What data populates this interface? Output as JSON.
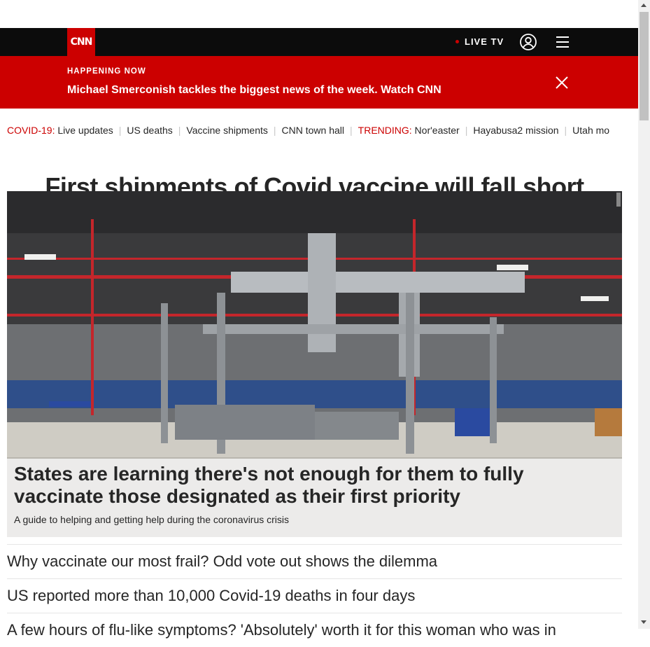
{
  "header": {
    "logo_text": "CNN",
    "live_tv_label": "LIVE TV",
    "user_icon": "user-icon",
    "menu_icon": "hamburger-menu-icon"
  },
  "banner": {
    "label": "HAPPENING NOW",
    "text": "Michael Smerconish tackles the biggest news of the week. Watch CNN",
    "close_icon": "close-icon"
  },
  "trending_bar": {
    "covid_label": "COVID-19:",
    "covid_items": [
      "Live updates",
      "US deaths",
      "Vaccine shipments",
      "CNN town hall"
    ],
    "trending_label": "TRENDING:",
    "trending_items": [
      "Nor'easter",
      "Hayabusa2 mission",
      "Utah mo"
    ]
  },
  "main": {
    "headline": "First shipments of Covid vaccine will fall short",
    "hero": {
      "title": "States are learning there's not enough for them to fully vaccinate those designated as their first priority",
      "subtitle": "A guide to helping and getting help during the coronavirus crisis"
    },
    "stories": [
      "Why vaccinate our most frail? Odd vote out shows the dilemma",
      "US reported more than 10,000 Covid-19 deaths in four days",
      "A few hours of flu-like symptoms? 'Absolutely' worth it for this woman who was in"
    ]
  },
  "colors": {
    "brand_red": "#cc0000",
    "topbar": "#0c0c0c",
    "text": "#262626"
  }
}
